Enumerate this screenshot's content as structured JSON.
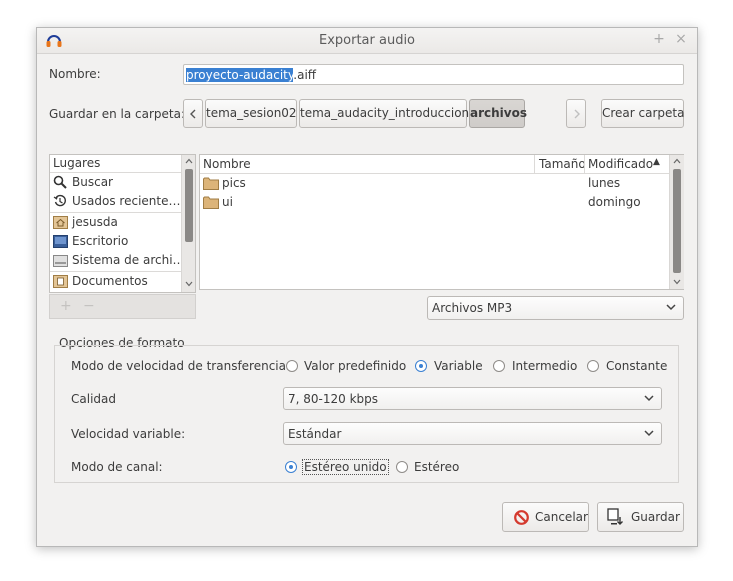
{
  "window": {
    "title": "Exportar audio"
  },
  "name_label": "Nombre:",
  "filename": {
    "selected": "proyecto-audacity",
    "rest": ".aiff"
  },
  "folder_label": "Guardar en la carpeta:",
  "breadcrumbs": [
    "tema_sesion02",
    "tema_audacity_introduccion",
    "archivos"
  ],
  "create_folder": "Crear carpeta",
  "places": {
    "header": "Lugares",
    "items": [
      "Buscar",
      "Usados reciente…",
      "jesusda",
      "Escritorio",
      "Sistema de archi…",
      "Documentos"
    ],
    "add": "+",
    "remove": "−"
  },
  "files": {
    "columns": [
      "Nombre",
      "Tamaño",
      "Modificado"
    ],
    "sort_arrow": "▲",
    "rows": [
      {
        "name": "pics",
        "size": "",
        "modified": "lunes"
      },
      {
        "name": "ui",
        "size": "",
        "modified": "domingo"
      }
    ]
  },
  "filetype": "Archivos MP3",
  "format": {
    "section": "Opciones de formato",
    "bitrate_mode_label": "Modo de velocidad de transferencia:",
    "bitrate_modes": [
      "Valor predefinido",
      "Variable",
      "Intermedio",
      "Constante"
    ],
    "bitrate_selected": "Variable",
    "quality_label": "Calidad",
    "quality_value": "7, 80-120 kbps",
    "vbr_label": "Velocidad variable:",
    "vbr_value": "Estándar",
    "channel_label": "Modo de canal:",
    "channel_modes": [
      "Estéreo unido",
      "Estéreo"
    ],
    "channel_selected": "Estéreo unido"
  },
  "buttons": {
    "cancel": "Cancelar",
    "save": "Guardar"
  },
  "colors": {
    "selection": "#3a80d2",
    "cancel_icon": "#d43a2f",
    "folder": "#c79a55"
  }
}
